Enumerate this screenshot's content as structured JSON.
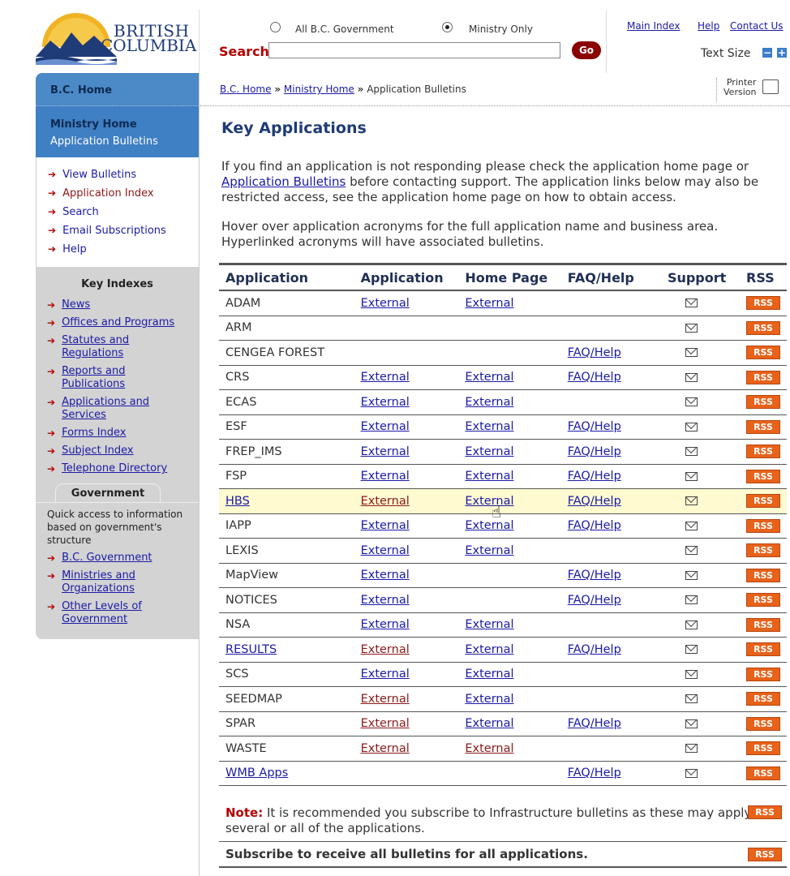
{
  "header": {
    "logo_line1": "BRITISH",
    "logo_line2": "COLUMBIA",
    "radio_all": "All B.C. Government",
    "radio_ministry": "Ministry Only",
    "search_label": "Search",
    "search_value": "",
    "go_label": "Go",
    "links": [
      "Main Index",
      "Help",
      "Contact Us"
    ],
    "text_size_label": "Text Size",
    "minus": "−",
    "plus": "+"
  },
  "sidebar": {
    "home": "B.C. Home",
    "ministry_home": "Ministry Home",
    "application_bulletins": "Application Bulletins",
    "nav": [
      "View Bulletins",
      "Application Index",
      "Search",
      "Email Subscriptions",
      "Help"
    ],
    "key_indexes_title": "Key Indexes",
    "key_indexes": [
      "News",
      "Offices and Programs",
      "Statutes and Regulations",
      "Reports and Publications",
      "Applications and Services",
      "Forms Index",
      "Subject Index",
      "Telephone Directory"
    ],
    "government_tab": "Government",
    "government_text": "Quick access to information based on government's structure",
    "government_links": [
      "B.C. Government",
      "Ministries and Organizations",
      "Other Levels of Government"
    ]
  },
  "breadcrumb": {
    "items": [
      "B.C. Home",
      "Ministry Home",
      "Application Bulletins"
    ],
    "sep": "»"
  },
  "printer": {
    "line1": "Printer",
    "line2": "Version"
  },
  "main": {
    "title": "Key Applications",
    "para1_a": "If you find an application is not responding please check the application home page or ",
    "para1_link": "Application Bulletins",
    "para1_b": " before contacting support.  The application links below may also be restricted access, see the application home page on how to obtain access.",
    "para2": "Hover over application acronyms for the full application name and business area. Hyperlinked acronyms will have associated bulletins."
  },
  "table": {
    "headers": [
      "Application",
      "Application",
      "Home Page",
      "FAQ/Help",
      "Support",
      "RSS"
    ],
    "rss_label": "RSS",
    "rows": [
      {
        "name": "ADAM",
        "app": "External",
        "home": "External",
        "faq": ""
      },
      {
        "name": "ARM",
        "app": "",
        "home": "",
        "faq": ""
      },
      {
        "name": "CENGEA FOREST",
        "app": "",
        "home": "",
        "faq": "FAQ/Help"
      },
      {
        "name": "CRS",
        "app": "External",
        "home": "External",
        "faq": "FAQ/Help"
      },
      {
        "name": "ECAS",
        "app": "External",
        "home": "External",
        "faq": ""
      },
      {
        "name": "ESF",
        "app": "External",
        "home": "External",
        "faq": "FAQ/Help"
      },
      {
        "name": "FREP_IMS",
        "app": "External",
        "home": "External",
        "faq": "FAQ/Help"
      },
      {
        "name": "FSP",
        "app": "External",
        "home": "External",
        "faq": "FAQ/Help"
      },
      {
        "name": "HBS",
        "app": "External",
        "home": "External",
        "faq": "FAQ/Help"
      },
      {
        "name": "IAPP",
        "app": "External",
        "home": "External",
        "faq": "FAQ/Help"
      },
      {
        "name": "LEXIS",
        "app": "External",
        "home": "External",
        "faq": ""
      },
      {
        "name": "MapView",
        "app": "External",
        "home": "",
        "faq": "FAQ/Help"
      },
      {
        "name": "NOTICES",
        "app": "External",
        "home": "",
        "faq": "FAQ/Help"
      },
      {
        "name": "NSA",
        "app": "External",
        "home": "External",
        "faq": ""
      },
      {
        "name": "RESULTS",
        "app": "External",
        "home": "External",
        "faq": "FAQ/Help"
      },
      {
        "name": "SCS",
        "app": "External",
        "home": "External",
        "faq": ""
      },
      {
        "name": "SEEDMAP",
        "app": "External",
        "home": "External",
        "faq": ""
      },
      {
        "name": "SPAR",
        "app": "External",
        "home": "External",
        "faq": "FAQ/Help"
      },
      {
        "name": "WASTE",
        "app": "External",
        "home": "External",
        "faq": ""
      },
      {
        "name": "WMB Apps",
        "app": "",
        "home": "",
        "faq": "FAQ/Help"
      }
    ]
  },
  "note": {
    "label": "Note:",
    "text": " It is recommended you subscribe to Infrastructure bulletins as these may apply to several or all of the applications."
  },
  "subscribe_all": "Subscribe to receive all bulletins for all applications."
}
